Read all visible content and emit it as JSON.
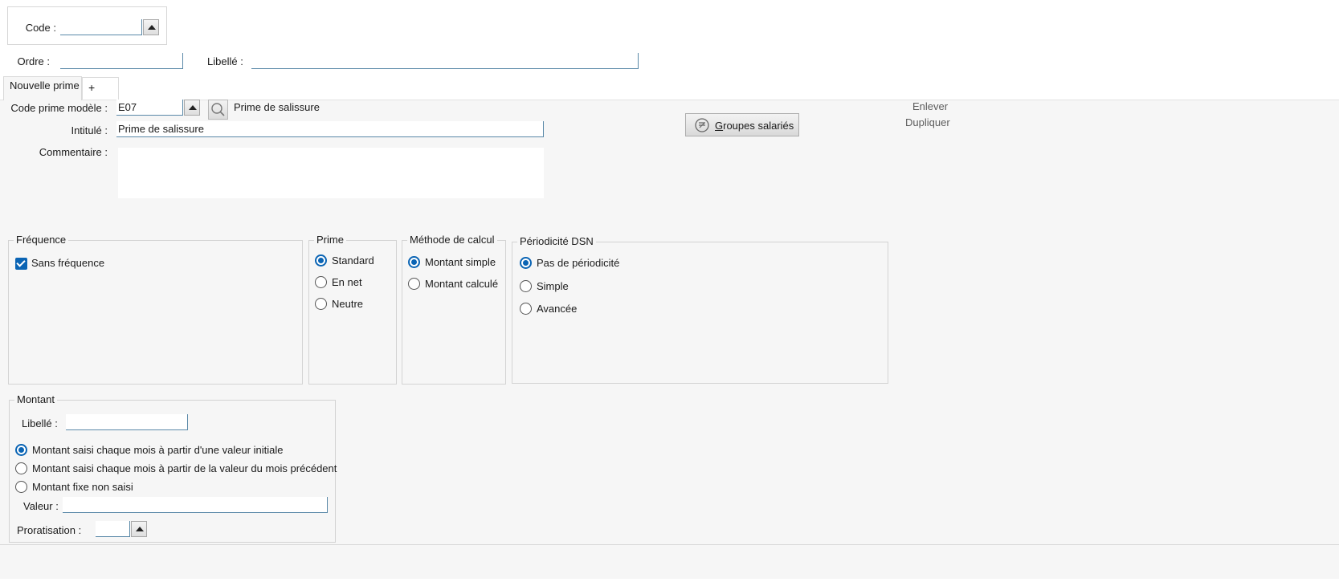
{
  "header": {
    "code_label": "Code :",
    "code_value": "",
    "ordre_label": "Ordre :",
    "ordre_value": "",
    "libelle_label": "Libellé :",
    "libelle_value": ""
  },
  "tabs": [
    {
      "label": "Nouvelle prime",
      "active": true
    },
    {
      "label": "+",
      "active": false
    }
  ],
  "form": {
    "code_prime_modele_label": "Code prime modèle :",
    "code_prime_modele_value": "E07",
    "code_prime_modele_desc": "Prime de salissure",
    "intitule_label": "Intitulé :",
    "intitule_value": "Prime de salissure",
    "commentaire_label": "Commentaire :",
    "commentaire_value": "",
    "groupes_button": "Groupes salariés",
    "enlever_link": "Enlever",
    "dupliquer_link": "Dupliquer"
  },
  "frequence": {
    "title": "Fréquence",
    "options": [
      {
        "label": "Sans fréquence",
        "checked": true
      }
    ]
  },
  "prime": {
    "title": "Prime",
    "options": [
      {
        "label": "Standard",
        "selected": true
      },
      {
        "label": "En net",
        "selected": false
      },
      {
        "label": "Neutre",
        "selected": false
      }
    ]
  },
  "methode": {
    "title": "Méthode de calcul",
    "options": [
      {
        "label": "Montant simple",
        "selected": true
      },
      {
        "label": "Montant calculé",
        "selected": false
      }
    ]
  },
  "periodicite": {
    "title": "Périodicité DSN",
    "options": [
      {
        "label": "Pas de périodicité",
        "selected": true
      },
      {
        "label": "Simple",
        "selected": false
      },
      {
        "label": "Avancée",
        "selected": false
      }
    ]
  },
  "montant": {
    "title": "Montant",
    "libelle_label": "Libellé :",
    "libelle_value": "",
    "options": [
      {
        "label": "Montant saisi chaque mois à partir d'une valeur initiale",
        "selected": true
      },
      {
        "label": "Montant saisi chaque mois à partir de la valeur du mois précédent",
        "selected": false
      },
      {
        "label": "Montant fixe non saisi",
        "selected": false
      }
    ],
    "valeur_label": "Valeur :",
    "valeur_value": "",
    "proratisation_label": "Proratisation :",
    "proratisation_value": ""
  },
  "colors": {
    "accent": "#0a64b4",
    "field_border": "#5a89a8",
    "panel_bg": "#f6f6f6"
  }
}
